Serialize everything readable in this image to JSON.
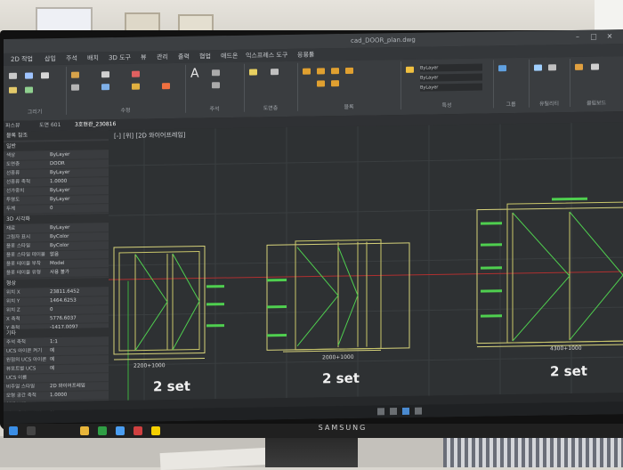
{
  "window": {
    "title": "cad_DOOR_plan.dwg",
    "controls": [
      "–",
      "□",
      "✕"
    ]
  },
  "menu": [
    "2D 작업",
    "삽입",
    "주석",
    "배치",
    "3D 도구",
    "뷰",
    "관리",
    "출력",
    "협업",
    "애드온",
    "익스프레스 도구",
    "응용툴"
  ],
  "ribbon_groups": [
    "그리기",
    "수정",
    "주석",
    "도면층",
    "블록",
    "특성",
    "그룹",
    "유틸리티",
    "클립보드"
  ],
  "ribbon_layer_value": "ByLayer",
  "tabs": [
    "파스뷰",
    "도면 601",
    "3호현관_230816"
  ],
  "view_label": "[-] [위] [2D 와이어프레임]",
  "properties": {
    "header_select": "블록 참조",
    "section_general": "일반",
    "section_3d": "3D 시각화",
    "section_geometry": "형상",
    "section_misc": "기타",
    "rows_general": [
      {
        "k": "색상",
        "v": "ByLayer"
      },
      {
        "k": "도면층",
        "v": "DOOR"
      },
      {
        "k": "선종류",
        "v": "ByLayer"
      },
      {
        "k": "선종류 축척",
        "v": "1.0000"
      },
      {
        "k": "선가중치",
        "v": "ByLayer"
      },
      {
        "k": "투명도",
        "v": "ByLayer"
      },
      {
        "k": "두께",
        "v": "0"
      }
    ],
    "rows_3d": [
      {
        "k": "재료",
        "v": "ByLayer"
      },
      {
        "k": "그림자 표시",
        "v": "ByColor"
      },
      {
        "k": "플롯 스타일",
        "v": "ByColor"
      },
      {
        "k": "플롯 스타일 테이블",
        "v": "없음"
      },
      {
        "k": "플롯 테이블 부착",
        "v": "Model"
      },
      {
        "k": "플롯 테이블 유형",
        "v": "사용 불가"
      }
    ],
    "rows_geometry": [
      {
        "k": "위치 X",
        "v": "23811.6452"
      },
      {
        "k": "위치 Y",
        "v": "1464.6253"
      },
      {
        "k": "위치 Z",
        "v": "0"
      },
      {
        "k": "X 축척",
        "v": "5776.6037"
      },
      {
        "k": "Y 축척",
        "v": "-1417.0097"
      }
    ],
    "rows_misc": [
      {
        "k": "주석 축척",
        "v": "1:1"
      },
      {
        "k": "UCS 아이콘 켜기",
        "v": "예"
      },
      {
        "k": "원점의 UCS 아이콘",
        "v": "예"
      },
      {
        "k": "뷰포트별 UCS",
        "v": "예"
      },
      {
        "k": "UCS 이름",
        "v": ""
      },
      {
        "k": "비주얼 스타일",
        "v": "2D 와이어프레임"
      },
      {
        "k": "모형 공간 축척",
        "v": "1.0000"
      },
      {
        "k": "형태 보기",
        "v": ""
      },
      {
        "k": "ViewCube 켜기",
        "v": "예"
      }
    ]
  },
  "drawings": [
    {
      "set_label": "2 set",
      "dimension": "2200+1000"
    },
    {
      "set_label": "2 set",
      "dimension": "2000+1000"
    },
    {
      "set_label": "2 set",
      "dimension": "4300+1000"
    }
  ],
  "monitor_brand": "SAMSUNG"
}
